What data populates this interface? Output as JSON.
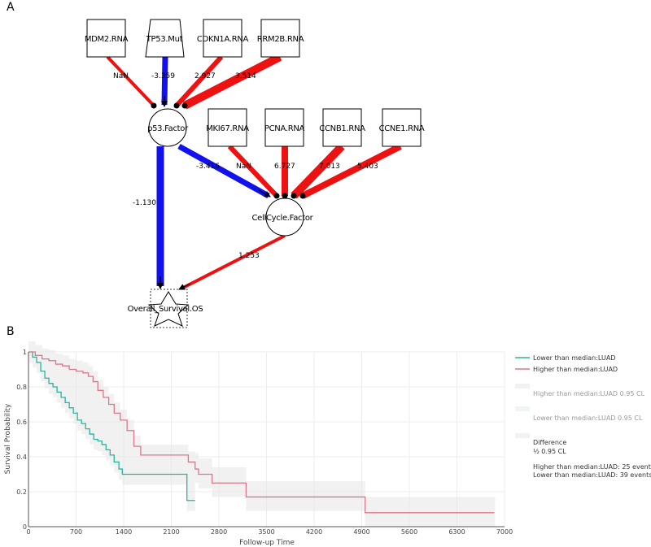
{
  "panel_a": {
    "letter": "A",
    "nodes": {
      "mdm2": "MDM2.RNA",
      "tp53": "TP53.Mut",
      "cdkn1a": "CDKN1A.RNA",
      "rrm2b": "RRM2B.RNA",
      "p53factor": "p53.Factor",
      "mki67": "MKI67.RNA",
      "pcna": "PCNA.RNA",
      "ccnb1": "CCNB1.RNA",
      "ccne1": "CCNE1.RNA",
      "cellcycle": "CellCycle.Factor",
      "os": "Overall_Survival.OS"
    },
    "edges": [
      {
        "from": "MDM2.RNA",
        "to": "p53.Factor",
        "label": "NaN",
        "color": "#ee1111",
        "weight": 4
      },
      {
        "from": "TP53.Mut",
        "to": "p53.Factor",
        "label": "-3.359",
        "color": "#1111ee",
        "weight": 7
      },
      {
        "from": "CDKN1A.RNA",
        "to": "p53.Factor",
        "label": "2.927",
        "color": "#ee1111",
        "weight": 6
      },
      {
        "from": "RRM2B.RNA",
        "to": "p53.Factor",
        "label": "3.514",
        "color": "#ee1111",
        "weight": 10
      },
      {
        "from": "p53.Factor",
        "to": "CellCycle.Factor",
        "label": "-3.416",
        "color": "#1111ee",
        "weight": 7
      },
      {
        "from": "MKI67.RNA",
        "to": "CellCycle.Factor",
        "label": "NaN",
        "color": "#ee1111",
        "weight": 6
      },
      {
        "from": "PCNA.RNA",
        "to": "CellCycle.Factor",
        "label": "6.727",
        "color": "#ee1111",
        "weight": 8
      },
      {
        "from": "CCNB1.RNA",
        "to": "CellCycle.Factor",
        "label": "7.013",
        "color": "#ee1111",
        "weight": 10
      },
      {
        "from": "CCNE1.RNA",
        "to": "CellCycle.Factor",
        "label": "5.403",
        "color": "#ee1111",
        "weight": 8
      },
      {
        "from": "p53.Factor",
        "to": "Overall_Survival.OS",
        "label": "-1.130",
        "color": "#1111ee",
        "weight": 9
      },
      {
        "from": "CellCycle.Factor",
        "to": "Overall_Survival.OS",
        "label": "1.253",
        "color": "#ee1111",
        "weight": 4
      }
    ]
  },
  "panel_b": {
    "letter": "B",
    "legend": {
      "lower": "Lower than median:LUAD",
      "higher": "Higher than median:LUAD",
      "higher_cl": "Higher than median:LUAD 0.95 CL",
      "lower_cl": "Lower than median:LUAD 0.95 CL",
      "difference": "Difference",
      "difference_cl": "½ 0.95 CL",
      "higher_events": "Higher than median:LUAD: 25 events",
      "lower_events": "Lower than median:LUAD: 39 events"
    }
  },
  "colors": {
    "lower": "#2bb3a0",
    "higher": "#d9788c",
    "band": "#e6e6e6",
    "grid": "#ededed"
  },
  "chart_data": {
    "type": "line",
    "title": "",
    "xlabel": "Follow-up Time",
    "ylabel": "Survival Probability",
    "xlim": [
      0,
      7000
    ],
    "ylim": [
      0,
      1
    ],
    "xticks": [
      "0",
      "700",
      "1400",
      "2100",
      "2800",
      "3500",
      "4200",
      "4900",
      "5600",
      "6300",
      "7000"
    ],
    "yticks": [
      "0",
      "0.2",
      "0.4",
      "0.6",
      "0.8",
      "1"
    ],
    "grid": true,
    "legend_position": "right",
    "series": [
      {
        "name": "Lower than median:LUAD",
        "key": "lower",
        "x": [
          0,
          60,
          120,
          180,
          240,
          300,
          360,
          420,
          480,
          540,
          600,
          660,
          720,
          780,
          840,
          900,
          960,
          1020,
          1080,
          1140,
          1200,
          1260,
          1330,
          1380,
          1420,
          2320,
          2330,
          2450
        ],
        "y": [
          1.0,
          0.97,
          0.94,
          0.89,
          0.85,
          0.82,
          0.8,
          0.77,
          0.74,
          0.71,
          0.68,
          0.65,
          0.61,
          0.59,
          0.56,
          0.53,
          0.5,
          0.49,
          0.47,
          0.44,
          0.41,
          0.37,
          0.33,
          0.3,
          0.3,
          0.3,
          0.15,
          0.15
        ]
      },
      {
        "name": "Higher than median:LUAD",
        "key": "higher",
        "x": [
          0,
          100,
          200,
          300,
          400,
          500,
          600,
          700,
          800,
          880,
          950,
          1020,
          1100,
          1180,
          1260,
          1350,
          1450,
          1550,
          1650,
          2300,
          2350,
          2450,
          2500,
          2600,
          2700,
          3200,
          4950,
          6850
        ],
        "y": [
          1.0,
          0.98,
          0.96,
          0.95,
          0.93,
          0.92,
          0.9,
          0.89,
          0.88,
          0.86,
          0.83,
          0.78,
          0.74,
          0.7,
          0.65,
          0.61,
          0.55,
          0.46,
          0.41,
          0.41,
          0.37,
          0.33,
          0.3,
          0.3,
          0.25,
          0.17,
          0.08,
          0.08
        ]
      }
    ]
  }
}
